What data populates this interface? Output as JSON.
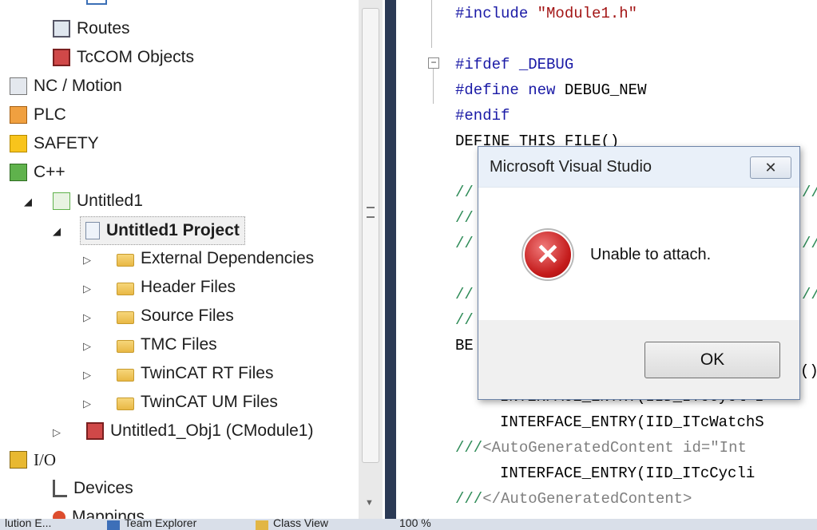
{
  "tree": {
    "items": [
      {
        "label": "Routes"
      },
      {
        "label": "TcCOM Objects"
      },
      {
        "label": "NC / Motion"
      },
      {
        "label": "PLC"
      },
      {
        "label": "SAFETY"
      },
      {
        "label": "C++"
      },
      {
        "label": "Untitled1"
      },
      {
        "label": "Untitled1 Project"
      },
      {
        "label": "External Dependencies"
      },
      {
        "label": "Header Files"
      },
      {
        "label": "Source Files"
      },
      {
        "label": "TMC Files"
      },
      {
        "label": "TwinCAT RT Files"
      },
      {
        "label": "TwinCAT UM Files"
      },
      {
        "label": "Untitled1_Obj1 (CModule1)"
      },
      {
        "label": "I/O"
      },
      {
        "label": "Devices"
      },
      {
        "label": "Mappings"
      }
    ]
  },
  "editor": {
    "lines": {
      "l1": "#include \"Module1.h\"",
      "l2": "#ifdef _DEBUG",
      "l3": "#define new DEBUG_NEW",
      "l4": "#endif",
      "l5": "DEFINE_THIS_FILE()",
      "l6": "//",
      "l7": "//",
      "l8": "//",
      "l9": "//",
      "l10": "//",
      "l11": "BE",
      "l12": "INTERFACE_ENTRY(IID_ITcWatchS",
      "l13": "///<AutoGeneratedContent id=\"Int",
      "l14": "INTERFACE_ENTRY(IID_ITcCycli",
      "l15": "///</AutoGeneratedContent>"
    }
  },
  "status": {
    "left": "lution E...",
    "team_explorer": "Team Explorer",
    "class_view": "Class View",
    "zoom": "100 %"
  },
  "dialog": {
    "title": "Microsoft Visual Studio",
    "close_glyph": "✕",
    "message": "Unable to attach.",
    "ok_label": "OK"
  },
  "colors": {
    "splitter": "#2b3a55",
    "preprocessor": "#1a1aa6",
    "string": "#a31515",
    "comment": "#2e8b57"
  }
}
